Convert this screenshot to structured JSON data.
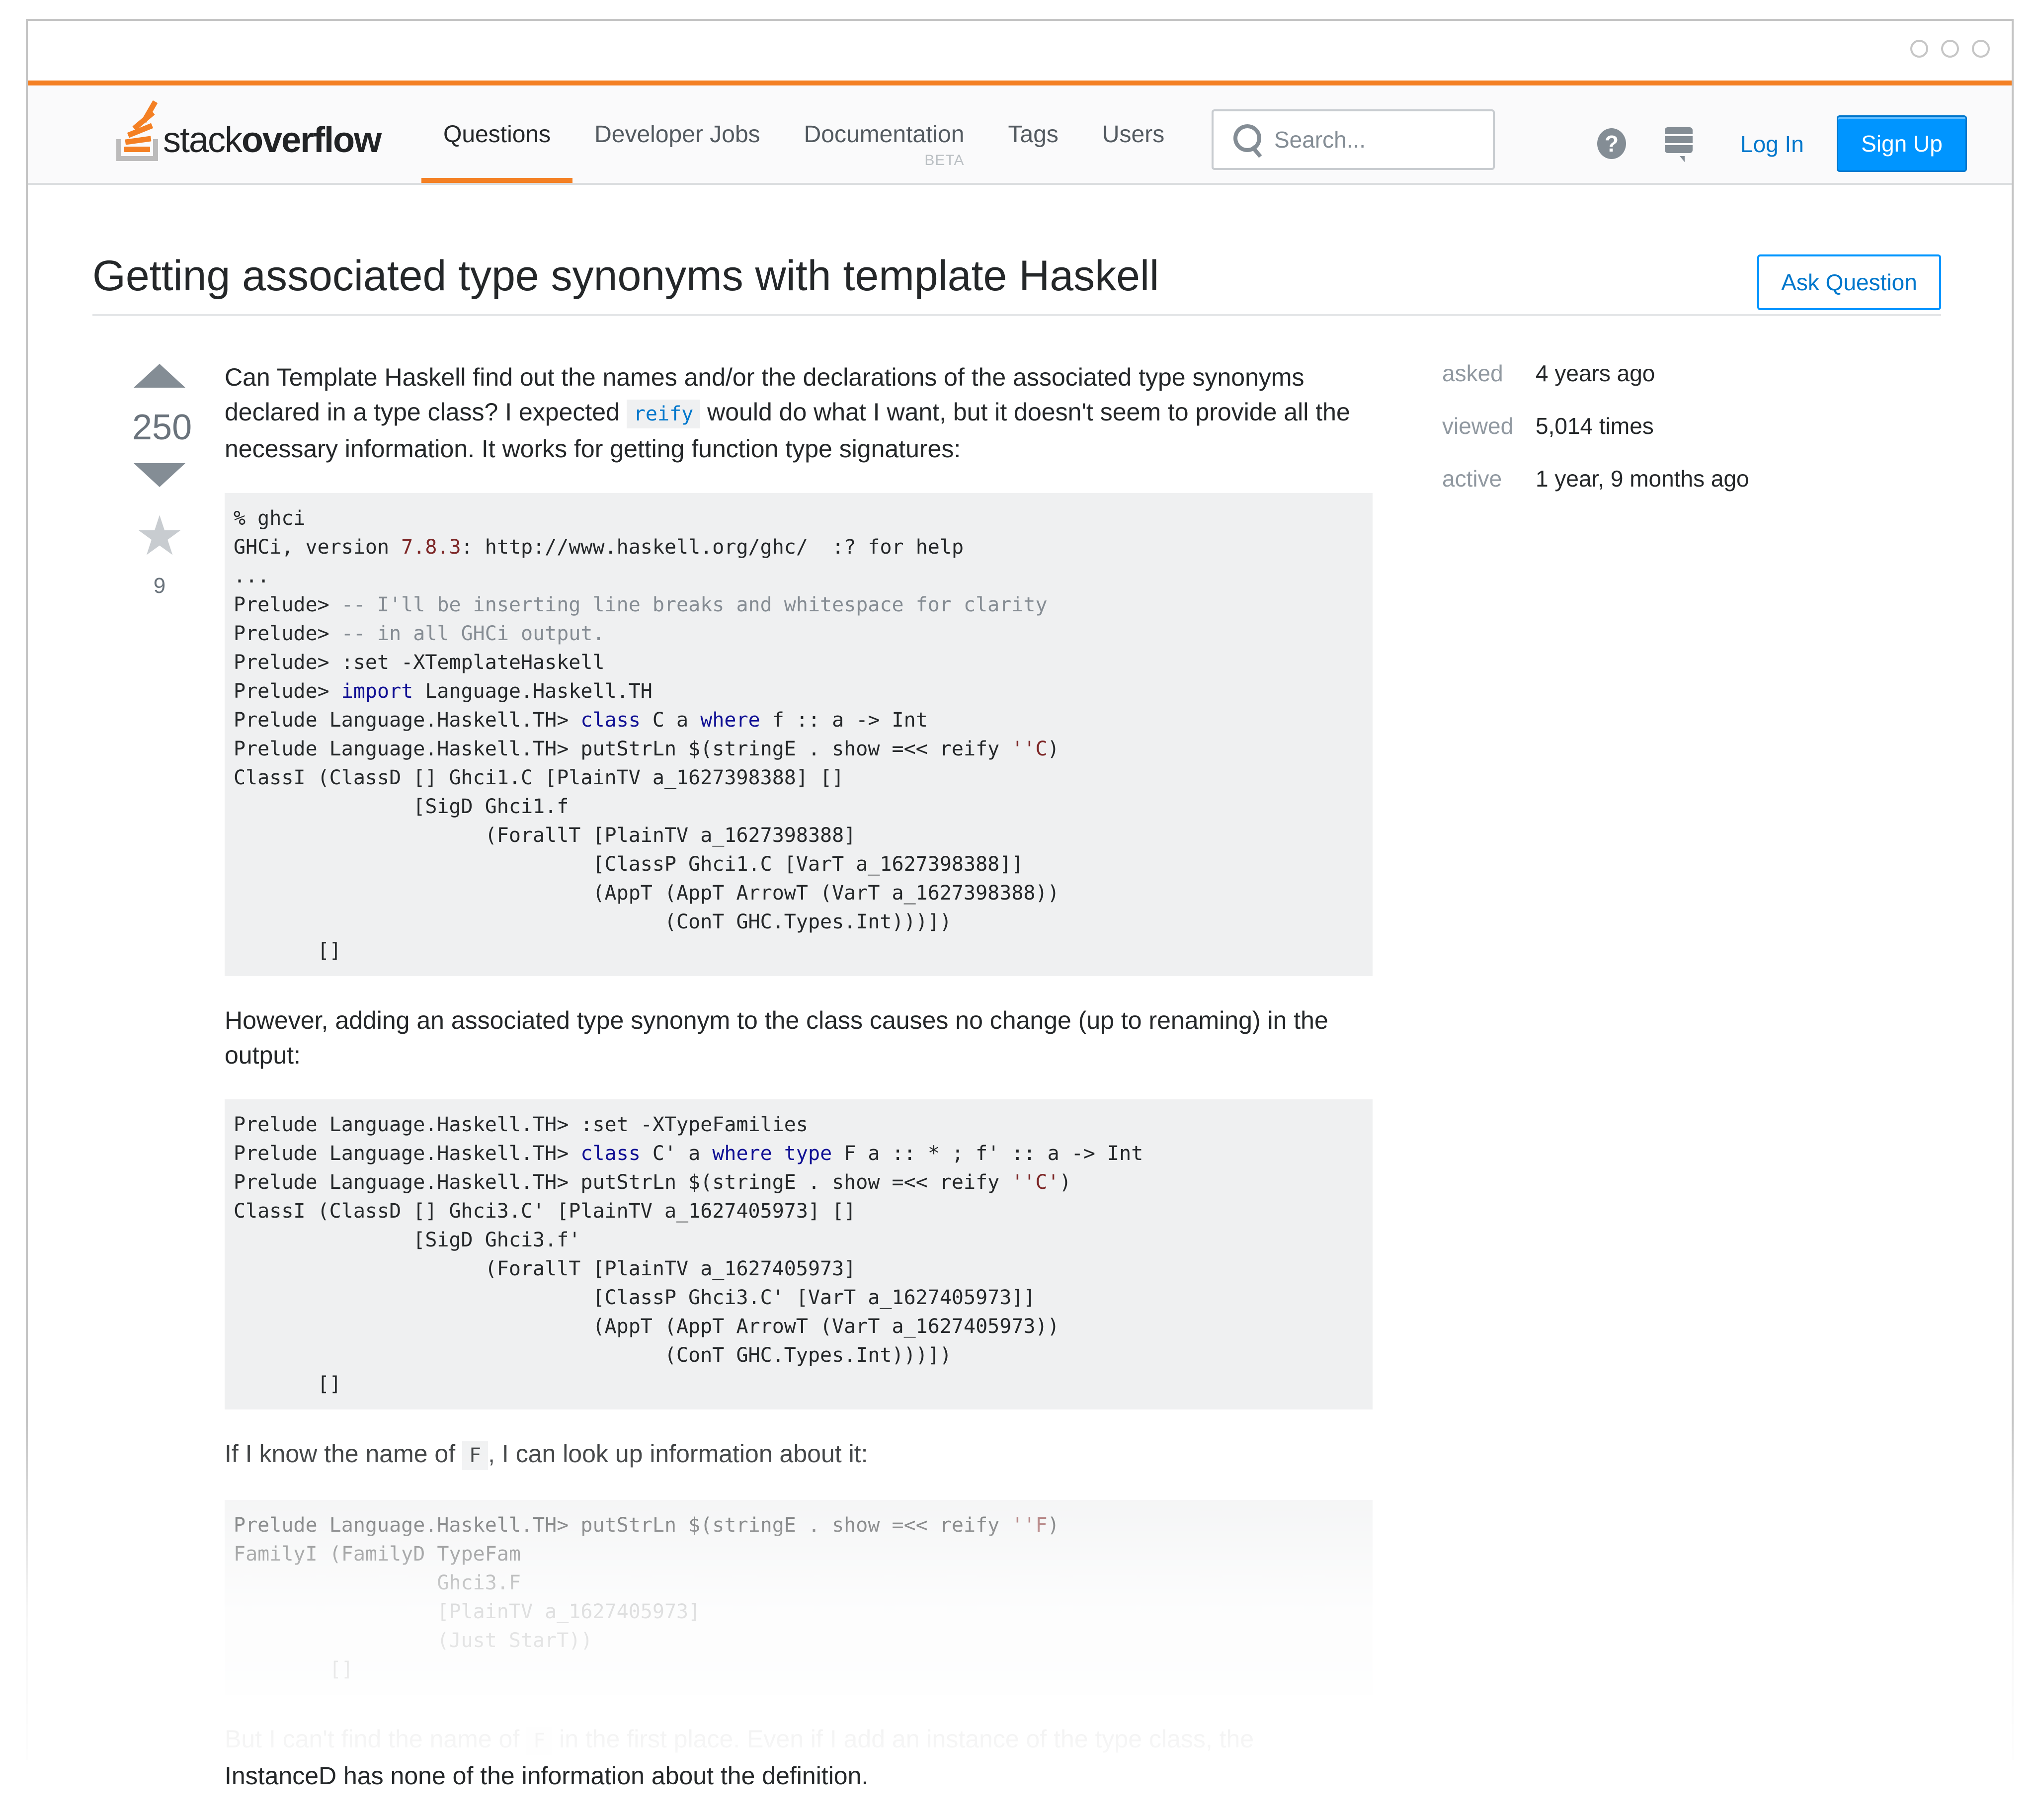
{
  "window": {
    "controls": [
      "window-control-1",
      "window-control-2",
      "window-control-3"
    ]
  },
  "header": {
    "logo": {
      "light": "stack",
      "bold": "overflow"
    },
    "nav": [
      {
        "label": "Questions",
        "active": true
      },
      {
        "label": "Developer Jobs",
        "active": false
      },
      {
        "label": "Documentation",
        "badge": "BETA",
        "active": false
      },
      {
        "label": "Tags",
        "active": false
      },
      {
        "label": "Users",
        "active": false
      }
    ],
    "search": {
      "placeholder": "Search...",
      "value": ""
    },
    "help_icon": "?",
    "login_label": "Log In",
    "signup_label": "Sign Up",
    "brand_color": "#f48024",
    "accent_color": "#0095ff"
  },
  "question": {
    "title": "Getting associated type synonyms with template Haskell",
    "ask_button": "Ask Question",
    "votes": "250",
    "favorites": "9",
    "body": {
      "p1_before": "Can Template Haskell find out the names and/or the declarations of the associated type synonyms declared in a type class? I expected ",
      "p1_code": "reify",
      "p1_after": " would do what I want, but it doesn't seem to provide all the necessary information. It works for getting function type signatures:",
      "p2": "However, adding an associated type synonym to the class causes no change (up to renaming) in the output:",
      "p3_before": "If I know the name of ",
      "p3_code": "F",
      "p3_after": ", I can look up information about it:",
      "p4_before": "But I can't find the name of ",
      "p4_code": "F",
      "p4_after": " in the first place. Even if I add an instance of the type class, the",
      "p4_line2": "InstanceD has none of the information about the definition."
    },
    "code_blocks": [
      [
        [
          {
            "t": "% ghci"
          }
        ],
        [
          {
            "t": "GHCi, version "
          },
          {
            "t": "7.8.3",
            "c": "lit"
          },
          {
            "t": ": http://www.haskell.org/ghc/  :? for help"
          }
        ],
        [
          {
            "t": "..."
          }
        ],
        [
          {
            "t": "Prelude> "
          },
          {
            "t": "-- I'll be inserting line breaks and whitespace for clarity",
            "c": "com"
          }
        ],
        [
          {
            "t": "Prelude> "
          },
          {
            "t": "-- in all GHCi output.",
            "c": "com"
          }
        ],
        [
          {
            "t": "Prelude> :set -XTemplateHaskell"
          }
        ],
        [
          {
            "t": "Prelude> "
          },
          {
            "t": "import",
            "c": "kw"
          },
          {
            "t": " Language.Haskell.TH"
          }
        ],
        [
          {
            "t": "Prelude Language.Haskell.TH> "
          },
          {
            "t": "class",
            "c": "kw"
          },
          {
            "t": " C a "
          },
          {
            "t": "where",
            "c": "kw"
          },
          {
            "t": " f :: a -> Int"
          }
        ],
        [
          {
            "t": "Prelude Language.Haskell.TH> putStrLn $(stringE . show =<< reify "
          },
          {
            "t": "''C",
            "c": "lit"
          },
          {
            "t": ")"
          }
        ],
        [
          {
            "t": "ClassI (ClassD [] Ghci1.C [PlainTV a_1627398388] []"
          }
        ],
        [
          {
            "t": "               [SigD Ghci1.f"
          }
        ],
        [
          {
            "t": "                     (ForallT [PlainTV a_1627398388]"
          }
        ],
        [
          {
            "t": "                              [ClassP Ghci1.C [VarT a_1627398388]]"
          }
        ],
        [
          {
            "t": "                              (AppT (AppT ArrowT (VarT a_1627398388))"
          }
        ],
        [
          {
            "t": "                                    (ConT GHC.Types.Int)))])"
          }
        ],
        [
          {
            "t": "       []"
          }
        ]
      ],
      [
        [
          {
            "t": "Prelude Language.Haskell.TH> :set -XTypeFamilies"
          }
        ],
        [
          {
            "t": "Prelude Language.Haskell.TH> "
          },
          {
            "t": "class",
            "c": "kw"
          },
          {
            "t": " C' a "
          },
          {
            "t": "where",
            "c": "kw"
          },
          {
            "t": " "
          },
          {
            "t": "type",
            "c": "kw"
          },
          {
            "t": " F a :: * ; f' :: a -> Int"
          }
        ],
        [
          {
            "t": "Prelude Language.Haskell.TH> putStrLn $(stringE . show =<< reify "
          },
          {
            "t": "''C'",
            "c": "lit"
          },
          {
            "t": ")"
          }
        ],
        [
          {
            "t": "ClassI (ClassD [] Ghci3.C' [PlainTV a_1627405973] []"
          }
        ],
        [
          {
            "t": "               [SigD Ghci3.f'"
          }
        ],
        [
          {
            "t": "                     (ForallT [PlainTV a_1627405973]"
          }
        ],
        [
          {
            "t": "                              [ClassP Ghci3.C' [VarT a_1627405973]]"
          }
        ],
        [
          {
            "t": "                              (AppT (AppT ArrowT (VarT a_1627405973))"
          }
        ],
        [
          {
            "t": "                                    (ConT GHC.Types.Int)))])"
          }
        ],
        [
          {
            "t": "       []"
          }
        ]
      ],
      [
        [
          {
            "t": "Prelude Language.Haskell.TH> putStrLn $(stringE . show =<< reify "
          },
          {
            "t": "''F",
            "c": "lit"
          },
          {
            "t": ")"
          }
        ],
        [
          {
            "t": "FamilyI (FamilyD TypeFam"
          }
        ],
        [
          {
            "t": "                 Ghci3.F"
          }
        ],
        [
          {
            "t": "                 [PlainTV a_1627405973]"
          }
        ],
        [
          {
            "t": "                 (Just StarT))"
          }
        ],
        [
          {
            "t": "        []"
          }
        ]
      ]
    ]
  },
  "sidebar": {
    "meta": [
      {
        "label": "asked",
        "value": "4 years ago"
      },
      {
        "label": "viewed",
        "value": "5,014 times"
      },
      {
        "label": "active",
        "value": "1 year, 9 months ago"
      }
    ]
  }
}
